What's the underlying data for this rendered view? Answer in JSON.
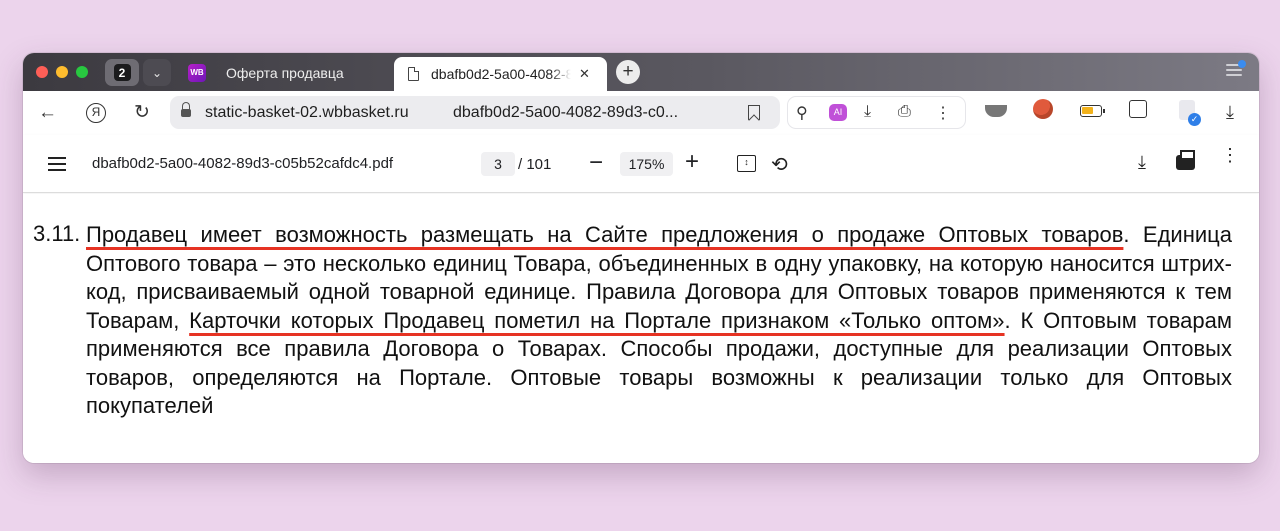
{
  "browser": {
    "tab_count": "2",
    "tabs": [
      {
        "label": "Оферта продавца",
        "favicon": "WB"
      },
      {
        "label": "dbafb0d2-5a00-4082-89d3-c05b52cafdc4.pdf",
        "active": true
      }
    ],
    "address": {
      "host": "static-basket-02.wbbasket.ru",
      "path": "dbafb0d2-5a00-4082-89d3-c0..."
    },
    "ai_badge_text": "AI"
  },
  "pdf_toolbar": {
    "file_name": "dbafb0d2-5a00-4082-89d3-c05b52cafdc4.pdf",
    "current_page": "3",
    "total_pages": "/ 101",
    "zoom": "175%"
  },
  "document": {
    "clause_number": "3.11.",
    "underlined_1": "Продавец имеет возможность размещать на Сайте предложения о продаже Оптовых товаров",
    "text_1": ". Единица Оптового товара – это несколько единиц Товара, объединенных в одну упаковку, на которую наносится штрих-код, присваиваемый одной товарной единице. Правила Договора для Оптовых товаров применяются к тем Товарам, ",
    "underlined_2": "Карточки которых Продавец пометил на Портале признаком «Только оптом»",
    "text_2": ". К Оптовым товарам применяются все правила Договора о Товарах. Способы продажи, доступные для реализации Оптовых товаров, определяются на Портале. Оптовые товары возможны к реализации только для Оптовых покупателей",
    "underline_color": "#e63323"
  }
}
